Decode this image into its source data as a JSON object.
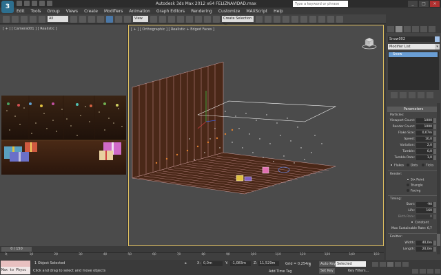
{
  "app": {
    "title": "Autodesk 3ds Max  2012 x64     FELIZNAVIDAD.max",
    "logo": "3ds-max-logo",
    "search_placeholder": "Type a keyword or phrase"
  },
  "menu": [
    "Edit",
    "Tools",
    "Group",
    "Views",
    "Create",
    "Modifiers",
    "Animation",
    "Graph Editors",
    "Rendering",
    "Customize",
    "MAXScript",
    "Help"
  ],
  "toolbar": {
    "selection_filter": "All",
    "reference_coord": "View",
    "named_selection": "Create Selection Se"
  },
  "viewports": {
    "camera_label": "[ + ] [ Camera001 ] [ Realistic ]",
    "ortho_label": "[ + ] [ Orthographic ] [ Realistic + Edged Faces ]"
  },
  "command_panel": {
    "object_name": "Snow002",
    "modifier_list": "Modifier List",
    "stack": [
      "Snow"
    ],
    "rollout": "Parameters",
    "particles_group": "Particles:",
    "params": [
      {
        "label": "Viewport Count:",
        "value": "1000"
      },
      {
        "label": "Render Count:",
        "value": "1000"
      },
      {
        "label": "Flake Size:",
        "value": "0,07m"
      },
      {
        "label": "Speed:",
        "value": "10,0"
      },
      {
        "label": "Variation:",
        "value": "2,0"
      },
      {
        "label": "Tumble:",
        "value": "0,0"
      },
      {
        "label": "Tumble Rate:",
        "value": "1,0"
      }
    ],
    "display_radios": [
      "Flakes",
      "Dots",
      "Ticks"
    ],
    "render_group": "Render:",
    "render_radios": [
      "Six Point",
      "Triangle",
      "Facing"
    ],
    "timing_group": "Timing:",
    "timing": [
      {
        "label": "Start:",
        "value": "-90"
      },
      {
        "label": "Life:",
        "value": "160"
      },
      {
        "label": "Birth Rate:",
        "value": "0"
      }
    ],
    "constant": "Constant",
    "max_rate": "Max Sustainable Rate: 6,7",
    "emitter_group": "Emitter:",
    "emitter": [
      {
        "label": "Width:",
        "value": "40,0m"
      },
      {
        "label": "Length:",
        "value": "20,0m"
      }
    ]
  },
  "timeline": {
    "frame": "0 / 150",
    "ticks": [
      "0",
      "10",
      "20",
      "30",
      "40",
      "50",
      "60",
      "70",
      "80",
      "90",
      "100",
      "110",
      "120",
      "130",
      "140",
      "150"
    ]
  },
  "status": {
    "maxscript": "Max to Physc",
    "selection": "1 Object Selected",
    "prompt": "Click and drag to select and move objects",
    "x": "0,0m",
    "y": "-1,083m",
    "z": "11,529m",
    "grid": "Grid = 0,254m",
    "auto_key": "Auto Key",
    "set_key": "Set Key",
    "selected": "Selected",
    "key_filters": "Key Filters...",
    "add_time_tag": "Add Time Tag"
  }
}
